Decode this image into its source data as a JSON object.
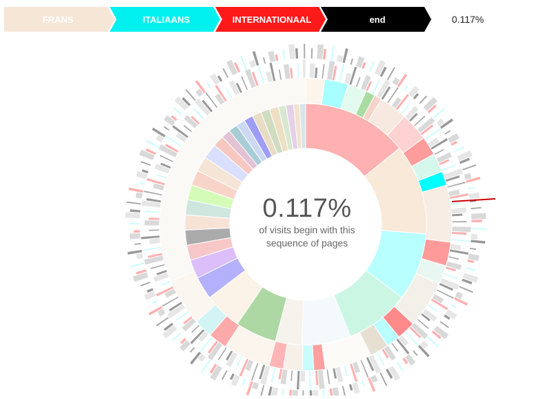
{
  "breadcrumb": {
    "crumbs": [
      {
        "label": "FRANS",
        "color": "#f5e6d6",
        "text_color": "#ffffff"
      },
      {
        "label": "ITALIAANS",
        "color": "#00f0f0",
        "text_color": "#ffffff"
      },
      {
        "label": "INTERNATIONAAL",
        "color": "#ff1a1a",
        "text_color": "#ffffff"
      },
      {
        "label": "end",
        "color": "#000000",
        "text_color": "#ffffff"
      }
    ],
    "percentage": "0.117%"
  },
  "center": {
    "percentage": "0.117%",
    "line1": "of visits begin with this",
    "line2": "sequence of pages"
  },
  "chart_data": {
    "type": "sunburst",
    "rings": [
      [
        {
          "share": 0.14,
          "color": "#ffb0b0"
        },
        {
          "share": 0.12,
          "color": "#f8e9d9"
        },
        {
          "share": 0.09,
          "color": "#b8ffff"
        },
        {
          "share": 0.085,
          "color": "#ccf6e4"
        },
        {
          "share": 0.065,
          "color": "#f4fafc"
        },
        {
          "share": 0.035,
          "color": "#f6f3ec"
        },
        {
          "share": 0.055,
          "color": "#add8a4"
        },
        {
          "share": 0.05,
          "color": "#fbf3e8"
        },
        {
          "share": 0.03,
          "color": "#b4b0fb"
        },
        {
          "share": 0.025,
          "color": "#dcbefa"
        },
        {
          "share": 0.02,
          "color": "#f7c7c7"
        },
        {
          "share": 0.02,
          "color": "#ababab"
        },
        {
          "share": 0.02,
          "color": "#f7e2d6"
        },
        {
          "share": 0.02,
          "color": "#cfe6df"
        },
        {
          "share": 0.02,
          "color": "#d4fcb8"
        },
        {
          "share": 0.02,
          "color": "#f8d4c8"
        },
        {
          "share": 0.02,
          "color": "#f5e5d6"
        },
        {
          "share": 0.02,
          "color": "#d9dfff"
        },
        {
          "share": 0.015,
          "color": "#f7c8c1"
        },
        {
          "share": 0.012,
          "color": "#e3c2d3"
        },
        {
          "share": 0.012,
          "color": "#a9cdd6"
        },
        {
          "share": 0.012,
          "color": "#cdd9f2"
        },
        {
          "share": 0.012,
          "color": "#9e9cf5"
        },
        {
          "share": 0.012,
          "color": "#e8dcc4"
        },
        {
          "share": 0.012,
          "color": "#cfdcc0"
        },
        {
          "share": 0.012,
          "color": "#eddfc4"
        },
        {
          "share": 0.01,
          "color": "#d8e8d0"
        },
        {
          "share": 0.01,
          "color": "#e4d0e8"
        },
        {
          "share": 0.008,
          "color": "#f2e2cf"
        },
        {
          "share": 0.008,
          "color": "#d7e4e9"
        }
      ],
      [
        {
          "share": 0.02,
          "color": "#fdf5ec"
        },
        {
          "share": 0.025,
          "color": "#a8ffff"
        },
        {
          "share": 0.02,
          "color": "#e3fbee"
        },
        {
          "share": 0.01,
          "color": "#a9dca1"
        },
        {
          "share": 0.008,
          "color": "#f6d3c8"
        },
        {
          "share": 0.03,
          "color": "#f7e9e0"
        },
        {
          "share": 0.03,
          "color": "#ffd2d2"
        },
        {
          "share": 0.02,
          "color": "#ff9c9c"
        },
        {
          "share": 0.02,
          "color": "#d6f7ec"
        },
        {
          "share": 0.015,
          "color": "#00ffff"
        },
        {
          "share": 0.06,
          "color": "#f7ede4"
        },
        {
          "share": 0.025,
          "color": "#ff9a9a"
        },
        {
          "share": 0.02,
          "color": "#e9f7f2"
        },
        {
          "share": 0.05,
          "color": "#f3f0ea"
        },
        {
          "share": 0.02,
          "color": "#ff8a8a"
        },
        {
          "share": 0.015,
          "color": "#b9ffff"
        },
        {
          "share": 0.02,
          "color": "#e8dfd3"
        },
        {
          "share": 0.05,
          "color": "#fdfbf8"
        },
        {
          "share": 0.012,
          "color": "#ff9f9f"
        },
        {
          "share": 0.012,
          "color": "#c8fcff"
        },
        {
          "share": 0.02,
          "color": "#f7f0e9"
        },
        {
          "share": 0.015,
          "color": "#ffb5b5"
        },
        {
          "share": 0.05,
          "color": "#fcf5ee"
        },
        {
          "share": 0.02,
          "color": "#ffaaaa"
        },
        {
          "share": 0.02,
          "color": "#d2f4f4"
        },
        {
          "share": 0.05,
          "color": "#fbf6f0"
        },
        {
          "share": 0.3,
          "color": "#fbf9f6"
        }
      ]
    ]
  }
}
